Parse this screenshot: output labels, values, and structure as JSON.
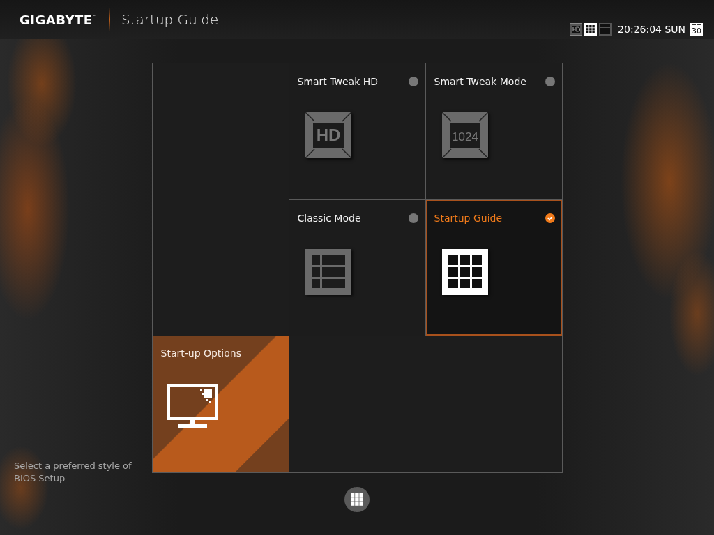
{
  "header": {
    "brand": "GIGABYTE",
    "brand_mark": "™",
    "title": "Startup Guide"
  },
  "status": {
    "view_icons": [
      {
        "kind": "hd",
        "selected": false
      },
      {
        "kind": "grid",
        "selected": true
      },
      {
        "kind": "classic",
        "selected": false
      }
    ],
    "time": "20:26:04 SUN",
    "calendar_day": "30"
  },
  "modes": [
    {
      "kind": "hd",
      "title": "Smart Tweak HD",
      "icon_text": "HD",
      "selected": false
    },
    {
      "kind": "mode",
      "title": "Smart Tweak Mode",
      "icon_text": "1024",
      "selected": false
    },
    {
      "kind": "classic",
      "title": "Classic Mode",
      "selected": false
    },
    {
      "kind": "grid",
      "title": "Startup Guide",
      "selected": true
    }
  ],
  "options_tile": {
    "title": "Start-up Options"
  },
  "hint": "Select a preferred style of BIOS Setup"
}
